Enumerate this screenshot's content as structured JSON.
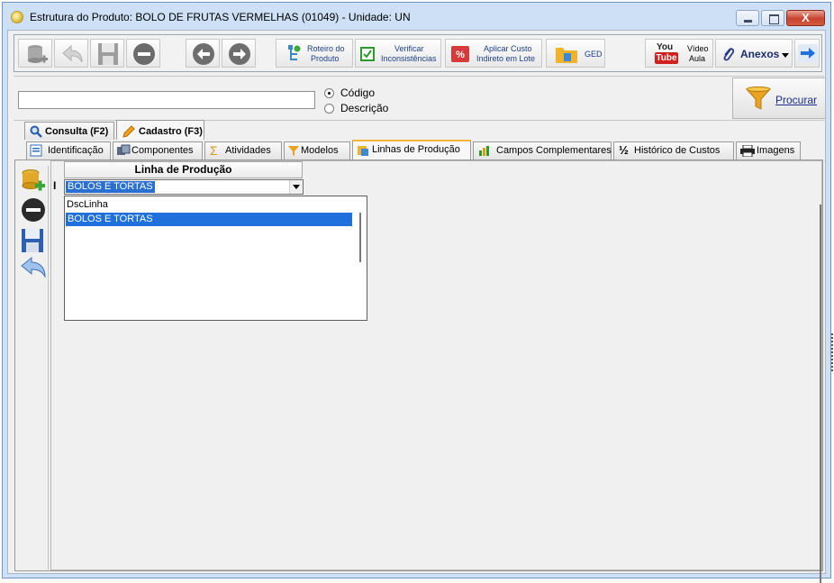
{
  "window": {
    "title": "Estrutura do Produto: BOLO DE FRUTAS VERMELHAS  (01049)   - Unidade: UN",
    "close_glyph": "X"
  },
  "toolbar": {
    "roteiro": [
      "Roteiro do",
      "Produto"
    ],
    "verificar": [
      "Verificar",
      "Inconsistências"
    ],
    "aplicar": [
      "Aplicar Custo",
      "Indireto em Lote"
    ],
    "ged": "GED",
    "video": [
      "Vídeo",
      "Aula"
    ],
    "youtube": [
      "You",
      "Tube"
    ],
    "anexos": "Anexos"
  },
  "search": {
    "value": "",
    "option_code": "Código",
    "option_desc": "Descrição",
    "selected": "Código",
    "button": "Procurar"
  },
  "tabs": [
    "Consulta (F2)",
    "Cadastro (F3)"
  ],
  "active_tab": "Cadastro (F3)",
  "subtabs": [
    "Identificação",
    "Componentes",
    "Atividades",
    "Modelos",
    "Linhas de Produção",
    "Campos Complementares",
    "Histórico de Custos",
    "Imagens"
  ],
  "active_subtab": "Linhas de Produção",
  "grid": {
    "column": "Linha de Produção",
    "row_indicator": "I",
    "current_value": "BOLOS E TORTAS",
    "dropdown_header": "DscLinha",
    "dropdown_items": [
      "BOLOS E TORTAS"
    ]
  },
  "colors": {
    "accent": "#1f6fdc",
    "titlebar": "#cde0f5",
    "active_tab_marker": "#f4b43a"
  }
}
